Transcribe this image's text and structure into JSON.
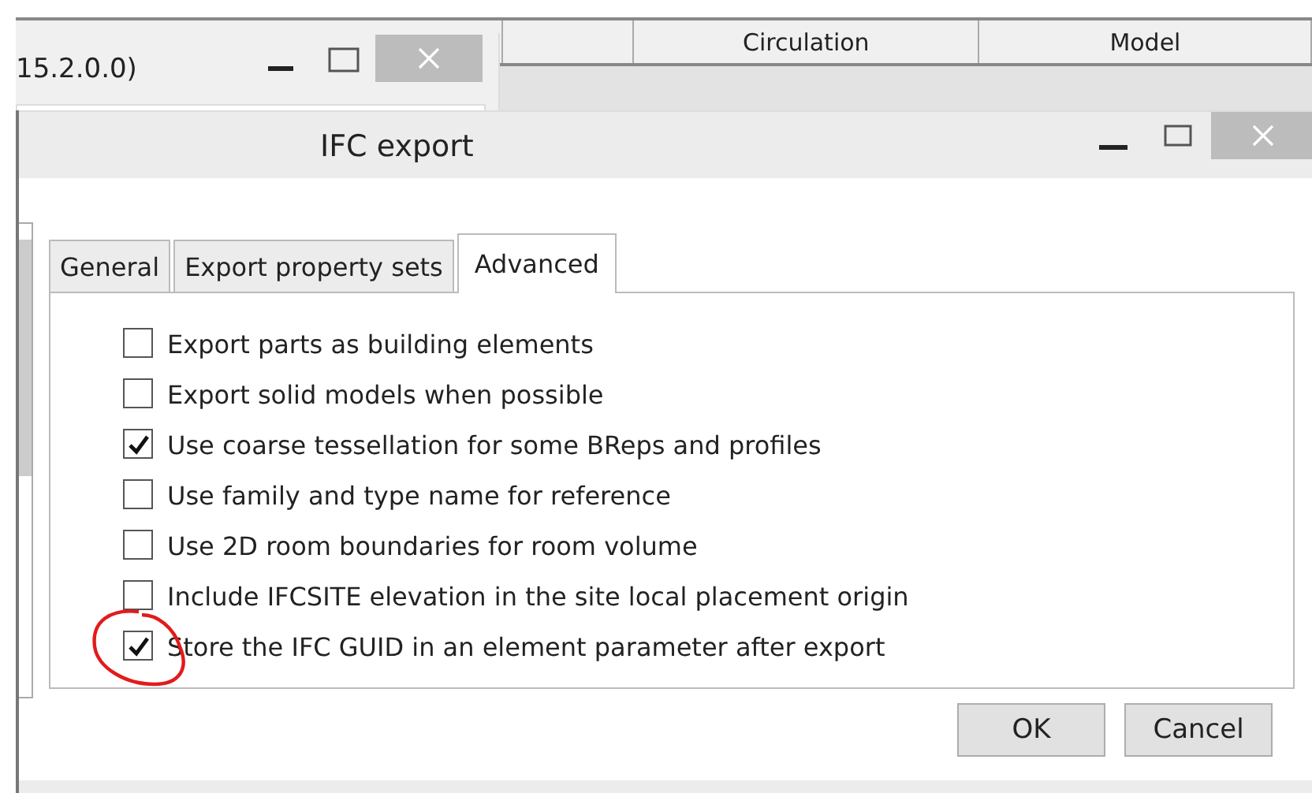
{
  "background_table": {
    "columns": [
      "",
      "Circulation",
      "Model"
    ]
  },
  "background_window": {
    "title": "15.2.0.0)"
  },
  "dialog": {
    "title": "IFC export"
  },
  "tabs": [
    {
      "label": "General",
      "selected": false
    },
    {
      "label": "Export property sets",
      "selected": false
    },
    {
      "label": "Advanced",
      "selected": true
    }
  ],
  "options": [
    {
      "label": "Export parts as building elements",
      "checked": false
    },
    {
      "label": "Export solid models when possible",
      "checked": false
    },
    {
      "label": "Use coarse tessellation for some BReps and profiles",
      "checked": true
    },
    {
      "label": "Use family and type name for reference",
      "checked": false
    },
    {
      "label": "Use 2D room boundaries for room volume",
      "checked": false
    },
    {
      "label": "Include IFCSITE elevation in the site local placement origin",
      "checked": false
    },
    {
      "label": "Store the IFC GUID in an element parameter after export",
      "checked": true
    }
  ],
  "buttons": [
    "OK",
    "Cancel"
  ]
}
